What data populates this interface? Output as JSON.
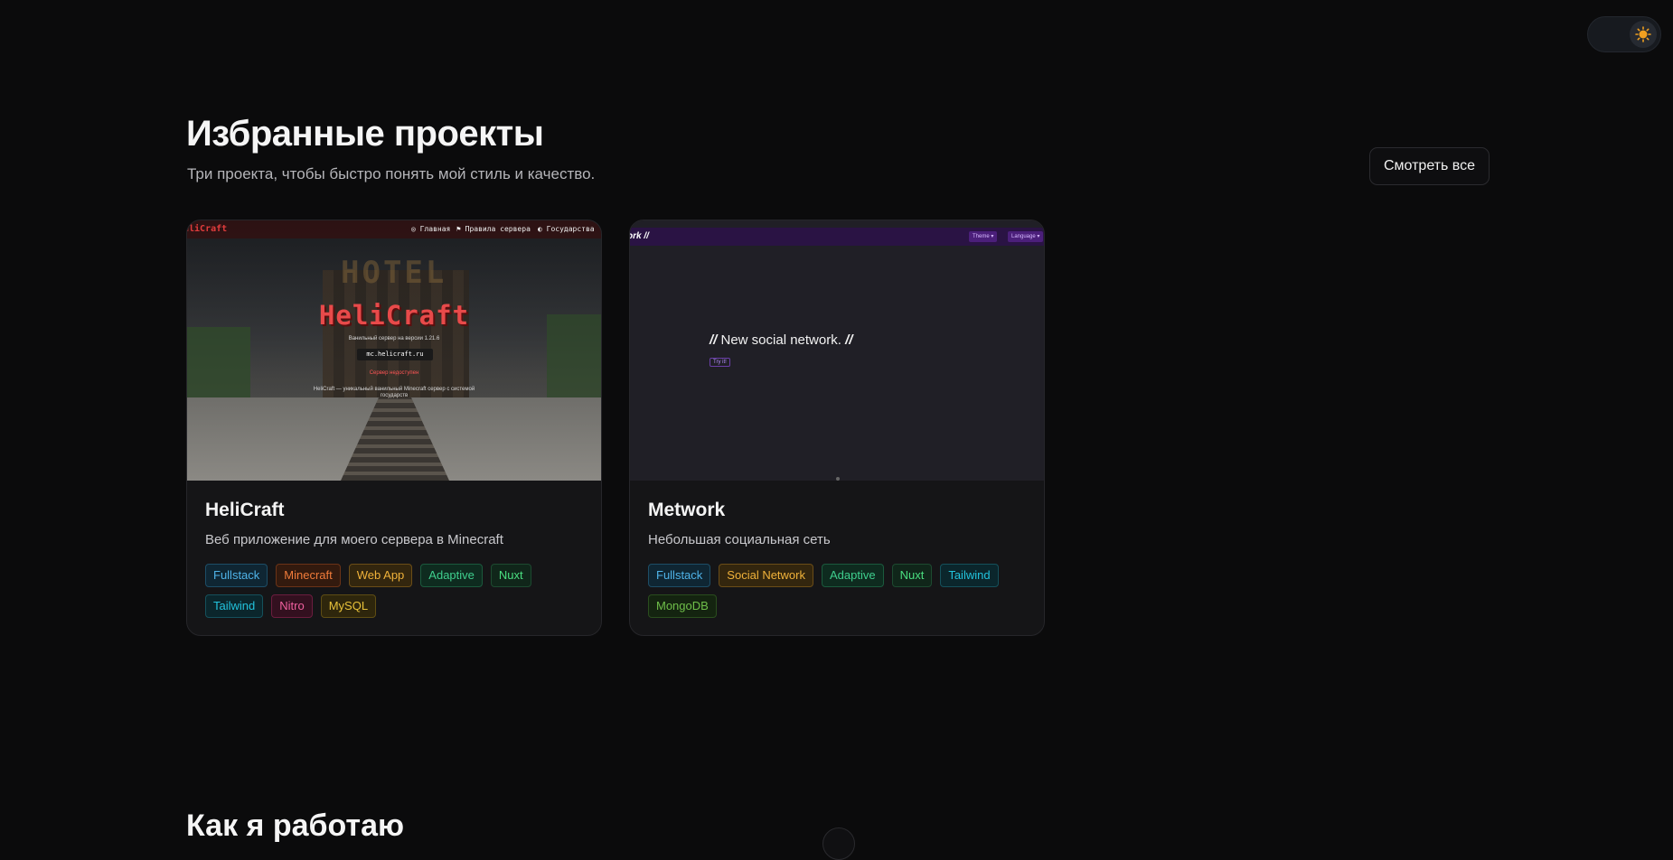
{
  "section": {
    "title": "Избранные проекты",
    "subtitle": "Три проекта, чтобы быстро понять мой стиль и качество.",
    "view_all_label": "Смотреть все"
  },
  "theme_toggle": {
    "icon": "sun-icon",
    "accent": "#f0a020"
  },
  "projects": [
    {
      "title": "HeliCraft",
      "description": "Веб приложение для моего сервера в Minecraft",
      "tags": [
        "Fullstack",
        "Minecraft",
        "Web App",
        "Adaptive",
        "Nuxt",
        "Tailwind",
        "Nitro",
        "MySQL"
      ],
      "preview": {
        "logo": "eliCraft",
        "nav": [
          "◎ Главная",
          "⚑ Правила сервера",
          "◐ Государства"
        ],
        "hero_title": "HeliCraft",
        "hero_subtitle": "Ванильный сервер на версии 1.21.6",
        "server_ip": "mc.helicraft.ru",
        "status": "Сервер недоступен",
        "footer_line1": "HeliCraft — уникальный ванильный Minecraft сервер с системой",
        "footer_line2": "государств",
        "billboard": "HOTEL"
      }
    },
    {
      "title": "Metwork",
      "description": "Небольшая социальная сеть",
      "tags": [
        "Fullstack",
        "Social Network",
        "Adaptive",
        "Nuxt",
        "Tailwind",
        "MongoDB"
      ],
      "preview": {
        "logo": "ork //",
        "theme_btn": "Theme ▾",
        "language_btn": "Language ▾",
        "headline_open": "//",
        "headline": " New social network. ",
        "headline_close": "//",
        "try_label": "Try it!"
      }
    }
  ],
  "next_section": {
    "title": "Как я работаю"
  }
}
